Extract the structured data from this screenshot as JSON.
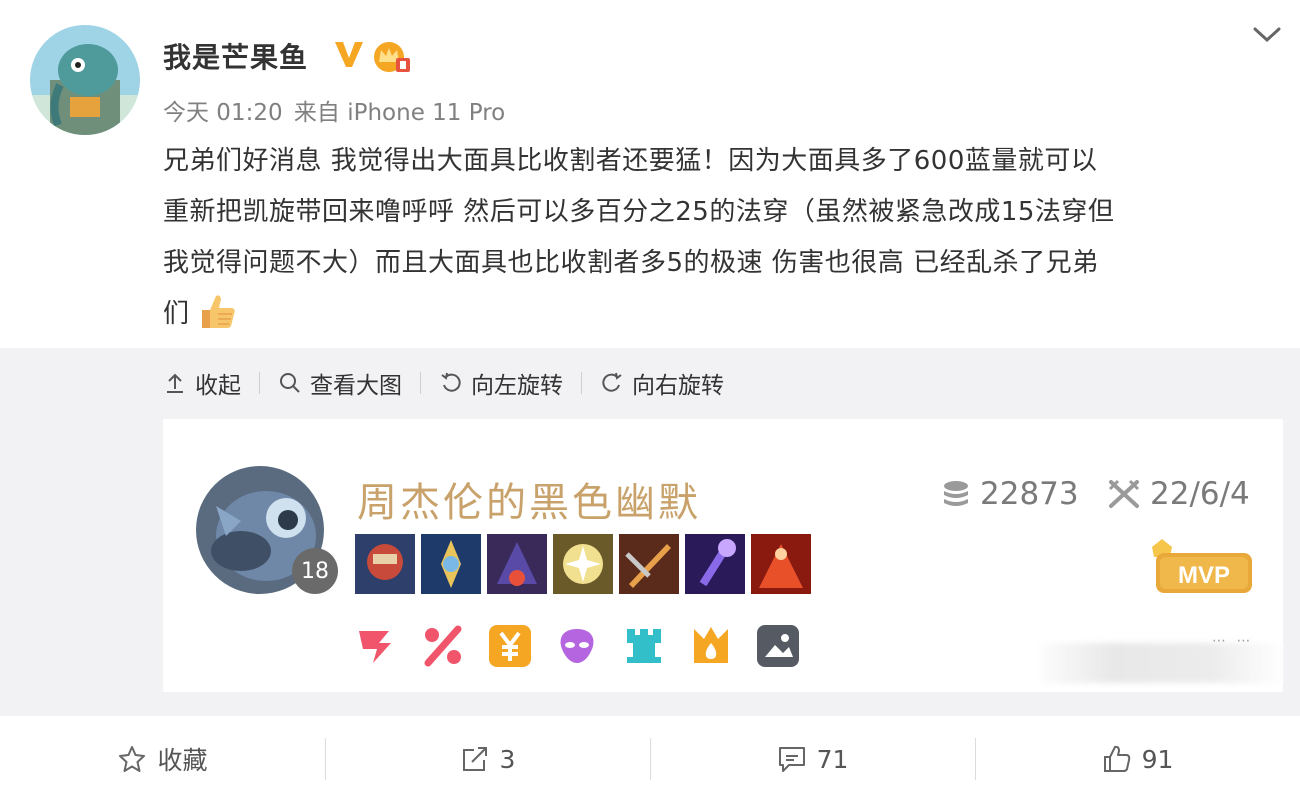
{
  "post": {
    "username": "我是芒果鱼",
    "time": "今天 01:20",
    "source": "来自 iPhone 11 Pro",
    "content_lines": [
      "兄弟们好消息 我觉得出大面具比收割者还要猛！因为大面具多了600蓝量就可以",
      "重新把凯旋带回来噜呼呼 然后可以多百分之25的法穿（虽然被紧急改成15法穿但",
      "我觉得问题不大）而且大面具也比收割者多5的极速 伤害也很高 已经乱杀了兄弟",
      "们"
    ],
    "emoji": "thumbs-up-icon"
  },
  "toolbar": {
    "collapse": "收起",
    "view_large": "查看大图",
    "rotate_left": "向左旋转",
    "rotate_right": "向右旋转"
  },
  "game_card": {
    "player_name": "周杰伦的黑色幽默",
    "level": "18",
    "gold": "22873",
    "date": "22/6/4",
    "mvp_label": "MVP",
    "item_icons": [
      "item-1",
      "item-2",
      "item-3",
      "item-4",
      "item-5",
      "item-6",
      "item-7"
    ],
    "achievement_icons": [
      "triple-kill-icon",
      "percent-icon",
      "yen-icon",
      "alien-icon",
      "tower-icon",
      "flame-icon",
      "picture-icon"
    ]
  },
  "actions": {
    "favorite": "收藏",
    "repost": "3",
    "comment": "71",
    "like": "91"
  },
  "colors": {
    "accent_gold": "#c8a26a",
    "vip_orange": "#f5a623",
    "text_gray": "#808080",
    "achievement_red": "#f0556b",
    "achievement_orange": "#f5a623",
    "achievement_purple": "#b565e0",
    "achievement_teal": "#33bfc9"
  }
}
